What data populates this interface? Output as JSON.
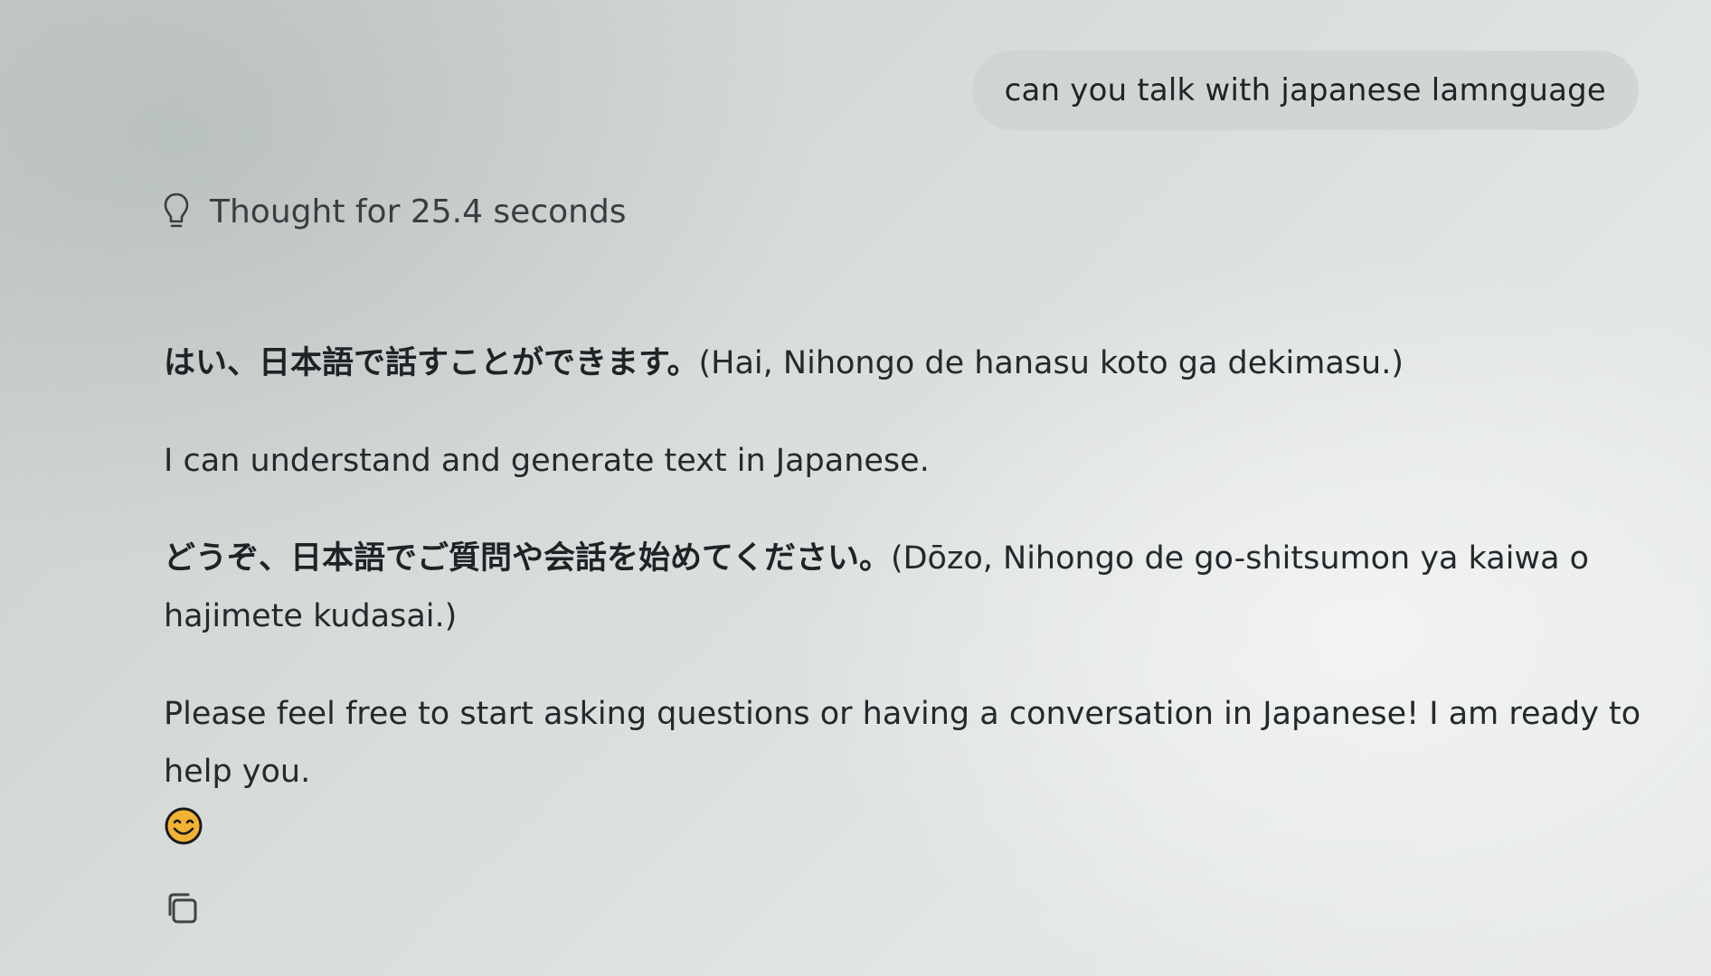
{
  "conversation": {
    "user_message": "can you talk with japanese lamnguage",
    "thought_label": "Thought for 25.4 seconds",
    "thought_icon": "lightbulb-icon",
    "response": {
      "p1_jp": "はい、日本語で話すことができます。",
      "p1_romaji": "(Hai, Nihongo de hanasu koto ga dekimasu.)",
      "p2": "I can understand and generate text in Japanese.",
      "p3_jp": "どうぞ、日本語でご質問や会話を始めてください。",
      "p3_romaji": "(Dōzo, Nihongo de go-shitsumon ya kaiwa o hajimete kudasai.)",
      "p4": "Please feel free to start asking questions or having a conversation in Japanese! I am ready to help you.",
      "emoji_icon": "smiling-face-icon"
    },
    "actions": {
      "copy_icon": "copy-icon"
    }
  },
  "colors": {
    "bubble": "#cdd3d1",
    "text": "#25282c",
    "emoji_fill": "#f2b233",
    "emoji_stroke": "#1a1a1a"
  }
}
